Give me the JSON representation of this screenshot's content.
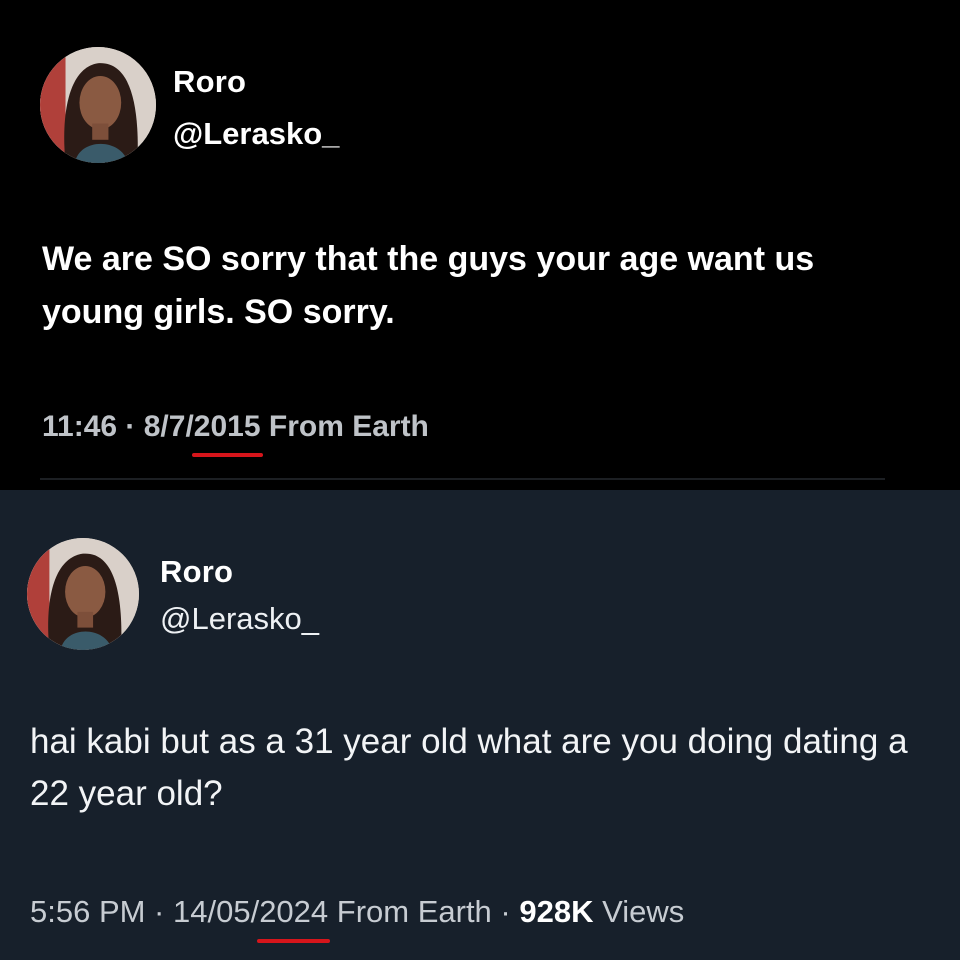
{
  "top_tweet": {
    "author": {
      "name": "Roro",
      "handle": "@Lerasko_"
    },
    "text": "We are SO sorry that the guys your age want us young girls. SO sorry.",
    "meta": {
      "time_date_prefix": "11:46 · 8/7/",
      "year": "2015",
      "source": " From Earth"
    }
  },
  "bottom_tweet": {
    "author": {
      "name": "Roro",
      "handle": "@Lerasko_"
    },
    "text": "hai kabi but as a 31 year old what are you doing dating a 22 year old?",
    "meta": {
      "time_date_prefix": "5:56 PM · 14/05/",
      "year": "2024",
      "source": " From Earth · ",
      "views_count": "928K",
      "views_label": " Views"
    }
  },
  "colors": {
    "top_background": "#000000",
    "bottom_background": "#17202b",
    "highlight_underline": "#d6151b"
  }
}
